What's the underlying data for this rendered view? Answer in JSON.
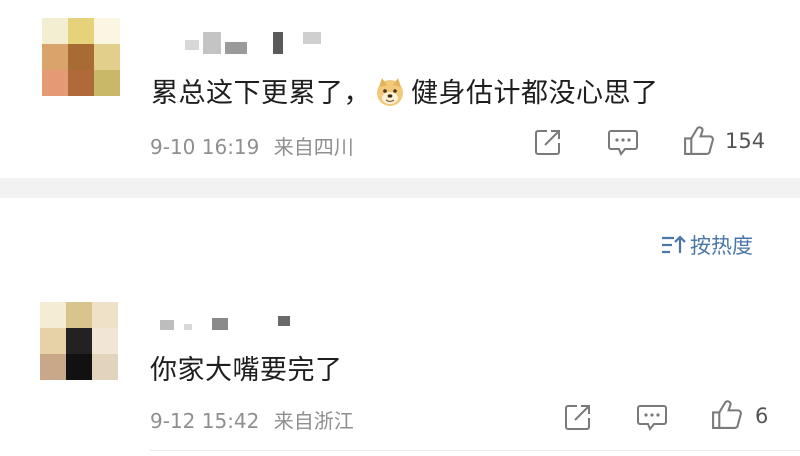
{
  "comments": [
    {
      "text_before": "累总这下更累了，",
      "emoji": "doge-emoji",
      "text_after": "健身估计都没心思了",
      "date": "9-10 16:19",
      "location": "来自四川",
      "likes": "154"
    },
    {
      "text": "你家大嘴要完了",
      "date": "9-12 15:42",
      "location": "来自浙江",
      "likes": "6"
    }
  ],
  "sort": {
    "icon": "sort-icon",
    "label": "按热度"
  },
  "icons": {
    "share": "share-icon",
    "comment": "comment-icon",
    "like": "thumbs-up-icon"
  },
  "colors": {
    "meta": "#8f8f8f",
    "sort_accent": "#4a76a8",
    "divider": "#f2f2f2"
  }
}
